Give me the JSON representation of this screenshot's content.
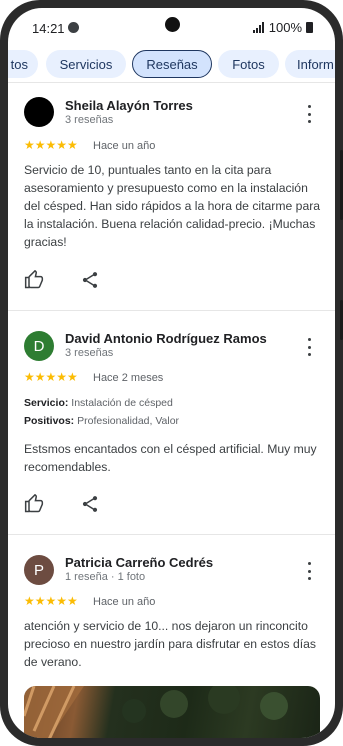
{
  "status_bar": {
    "time": "14:21",
    "battery": "100%"
  },
  "tabs": [
    "tos",
    "Servicios",
    "Reseñas",
    "Fotos",
    "Inform"
  ],
  "reviews": [
    {
      "name": "Sheila Alayón Torres",
      "meta": "3 reseñas",
      "avatar_letter": "",
      "avatar_color": "#000000",
      "stars": "★★★★★",
      "date": "Hace un año",
      "text": "Servicio de 10, puntuales tanto en la cita para asesoramiento y presupuesto como en la instalación del césped. Han sido rápidos a la hora de citarme para la instalación. Buena relación calidad-precio. ¡Muchas gracias!"
    },
    {
      "name": "David Antonio Rodríguez Ramos",
      "meta": "3 reseñas",
      "avatar_letter": "D",
      "avatar_color": "#2e7d32",
      "stars": "★★★★★",
      "date": "Hace 2 meses",
      "service_label": "Servicio:",
      "service_value": "Instalación de césped",
      "positive_label": "Positivos:",
      "positive_value": "Profesionalidad, Valor",
      "text": "Estsmos encantados con el césped artificial. Muy muy recomendables."
    },
    {
      "name": "Patricia Carreño Cedrés",
      "meta": "1 reseña · 1 foto",
      "avatar_letter": "P",
      "avatar_color": "#6d4c41",
      "stars": "★★★★★",
      "date": "Hace un año",
      "text": "atención y servicio de 10... nos dejaron un rinconcito precioso en nuestro jardín para disfrutar en estos días de verano."
    }
  ],
  "colors": {
    "star": "#fbbc04",
    "tab_bg": "#e8f0fe",
    "tab_text": "#1f3760"
  },
  "icons": [
    "thumb-up-icon",
    "share-icon",
    "more-vert-icon",
    "signal-icon",
    "battery-icon"
  ]
}
